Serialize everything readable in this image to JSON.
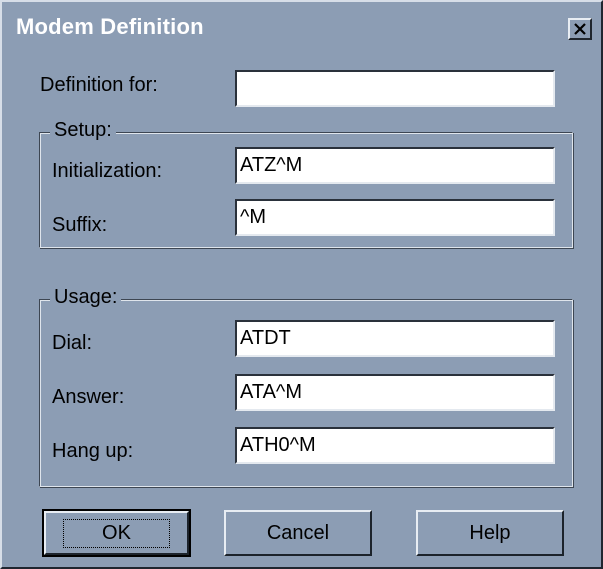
{
  "dialog": {
    "title": "Modem Definition",
    "close_icon": "close-icon"
  },
  "definition_for": {
    "label": "Definition for:",
    "value": ""
  },
  "setup": {
    "group_label": "Setup:",
    "initialization": {
      "label": "Initialization:",
      "value": "ATZ^M"
    },
    "suffix": {
      "label": "Suffix:",
      "value": "^M"
    }
  },
  "usage": {
    "group_label": "Usage:",
    "dial": {
      "label": "Dial:",
      "value": "ATDT"
    },
    "answer": {
      "label": "Answer:",
      "value": "ATA^M"
    },
    "hang_up": {
      "label": "Hang up:",
      "value": "ATH0^M"
    }
  },
  "buttons": {
    "ok": "OK",
    "cancel": "Cancel",
    "help": "Help"
  },
  "colors": {
    "dialog_background": "#8c9db4",
    "title_text": "#ffffff",
    "field_background": "#ffffff"
  }
}
